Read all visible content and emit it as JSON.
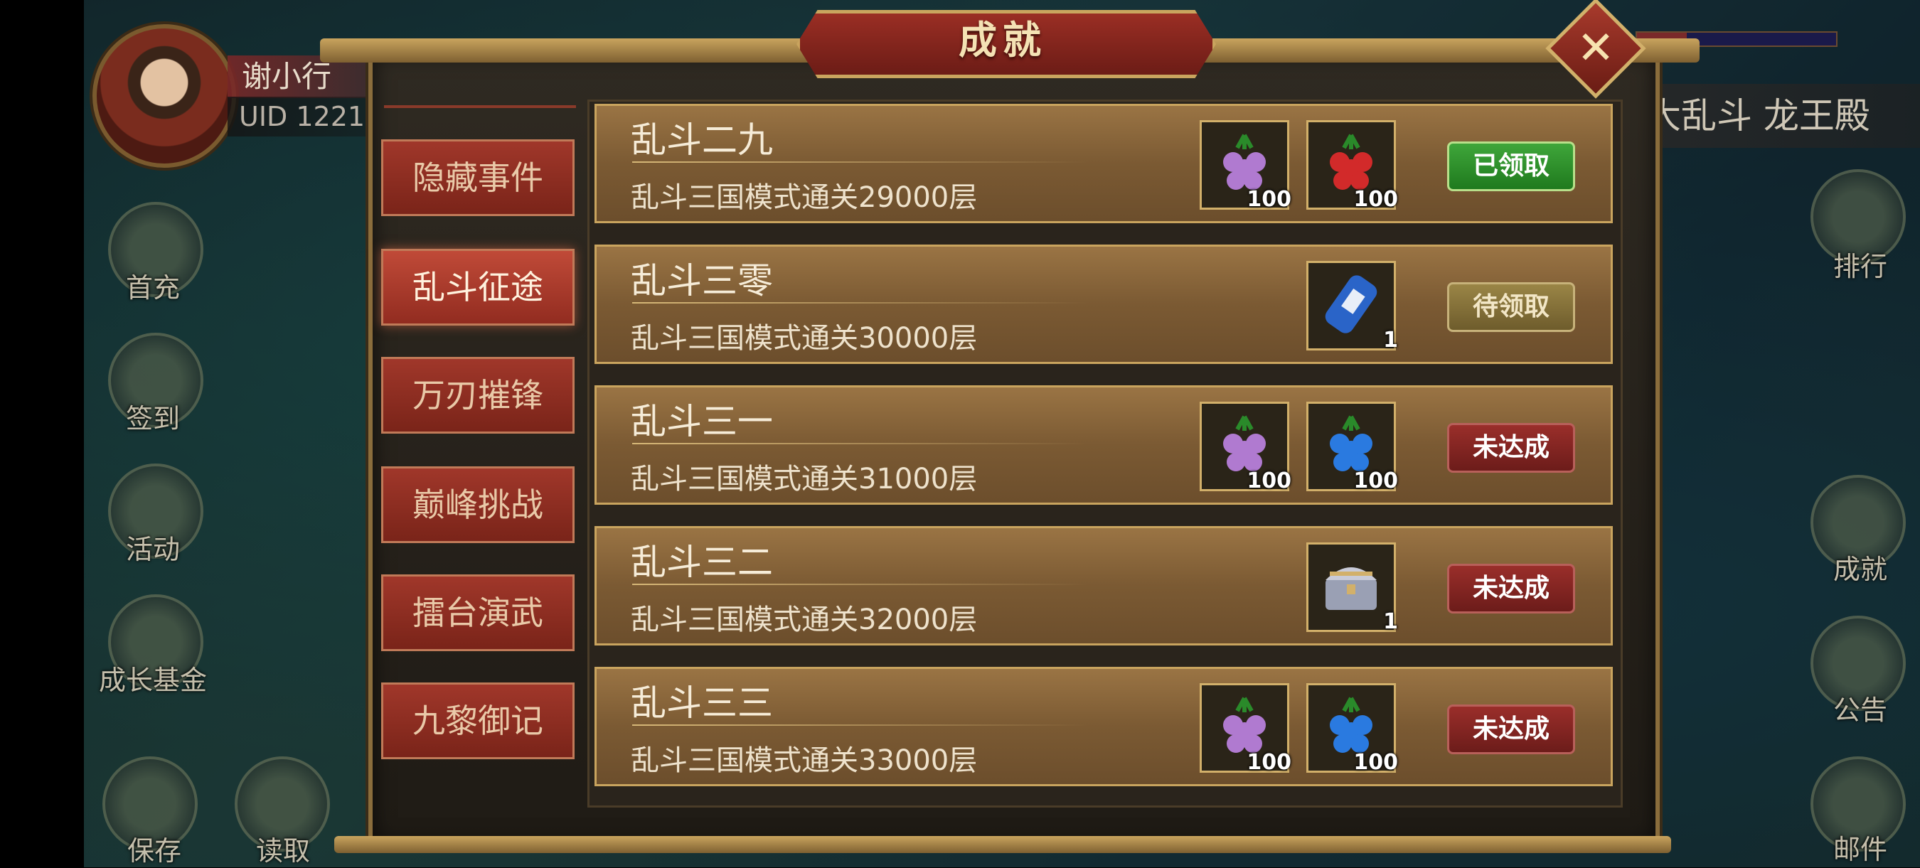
{
  "player": {
    "name": "谢小行",
    "uid": "UID  1221"
  },
  "left_menu": [
    {
      "label": "首充"
    },
    {
      "label": "签到"
    },
    {
      "label": "活动"
    },
    {
      "label": "成长基金"
    },
    {
      "label": "保存"
    },
    {
      "label": "读取"
    }
  ],
  "right_menu": [
    {
      "label": "排行"
    },
    {
      "label": "成就"
    },
    {
      "label": "公告"
    },
    {
      "label": "邮件"
    }
  ],
  "stage_title": "大乱斗 龙王殿",
  "dialog": {
    "title": "成就",
    "tabs": [
      {
        "label": "隐藏事件",
        "active": false
      },
      {
        "label": "乱斗征途",
        "active": true
      },
      {
        "label": "万刃摧锋",
        "active": false
      },
      {
        "label": "巅峰挑战",
        "active": false
      },
      {
        "label": "擂台演武",
        "active": false
      },
      {
        "label": "九黎御记",
        "active": false
      }
    ],
    "achievements": [
      {
        "name": "乱斗二九",
        "desc": "乱斗三国模式通关29000层",
        "rewards": [
          {
            "icon": "purple-grape-icon",
            "qty": "100",
            "color": "#b07ad0"
          },
          {
            "icon": "red-grape-icon",
            "qty": "100",
            "color": "#d22a2a"
          }
        ],
        "status": "已领取",
        "state": "claimed"
      },
      {
        "name": "乱斗三零",
        "desc": "乱斗三国模式通关30000层",
        "rewards": [
          {
            "icon": "scroll-icon",
            "qty": "1",
            "color": "#2a64c8"
          }
        ],
        "status": "待领取",
        "state": "pending"
      },
      {
        "name": "乱斗三一",
        "desc": "乱斗三国模式通关31000层",
        "rewards": [
          {
            "icon": "purple-grape-icon",
            "qty": "100",
            "color": "#b07ad0"
          },
          {
            "icon": "blue-grape-icon",
            "qty": "100",
            "color": "#2a7ae0"
          }
        ],
        "status": "未达成",
        "state": "unmet"
      },
      {
        "name": "乱斗三二",
        "desc": "乱斗三国模式通关32000层",
        "rewards": [
          {
            "icon": "treasure-chest-icon",
            "qty": "1",
            "color": "#c8c8d8"
          }
        ],
        "status": "未达成",
        "state": "unmet"
      },
      {
        "name": "乱斗三三",
        "desc": "乱斗三国模式通关33000层",
        "rewards": [
          {
            "icon": "purple-grape-icon",
            "qty": "100",
            "color": "#b07ad0"
          },
          {
            "icon": "blue-grape-icon",
            "qty": "100",
            "color": "#2a7ae0"
          }
        ],
        "status": "未达成",
        "state": "unmet"
      }
    ]
  }
}
